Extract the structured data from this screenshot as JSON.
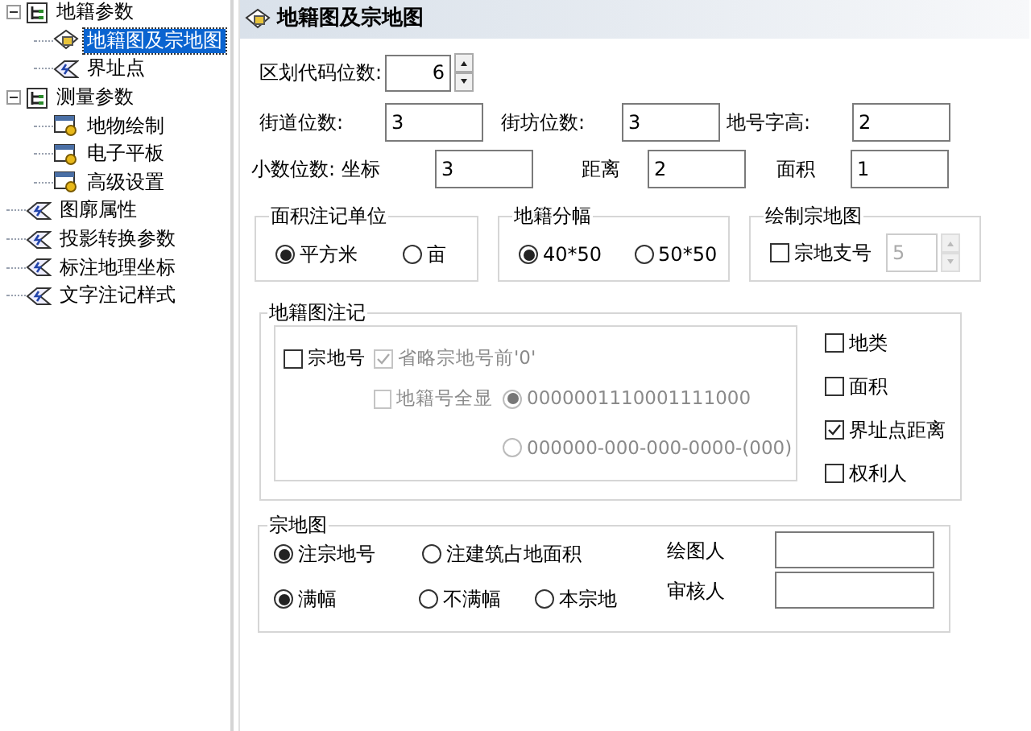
{
  "tree": [
    {
      "label": "地籍参数",
      "kind": "folder",
      "expanded": true,
      "selected": false,
      "children": [
        {
          "label": "地籍图及宗地图",
          "kind": "map",
          "selected": true
        },
        {
          "label": "界址点",
          "kind": "page",
          "selected": false
        }
      ]
    },
    {
      "label": "测量参数",
      "kind": "folder",
      "expanded": true,
      "selected": false,
      "children": [
        {
          "label": "地物绘制",
          "kind": "tool",
          "selected": false
        },
        {
          "label": "电子平板",
          "kind": "tool",
          "selected": false
        },
        {
          "label": "高级设置",
          "kind": "tool",
          "selected": false
        }
      ]
    },
    {
      "label": "图廓属性",
      "kind": "page",
      "selected": false
    },
    {
      "label": "投影转换参数",
      "kind": "page",
      "selected": false
    },
    {
      "label": "标注地理坐标",
      "kind": "page",
      "selected": false
    },
    {
      "label": "文字注记样式",
      "kind": "page",
      "selected": false
    }
  ],
  "title": "地籍图及宗地图",
  "code_digits": {
    "label": "区划代码位数:",
    "value": "6"
  },
  "row_street": [
    {
      "label": "街道位数:",
      "value": "3"
    },
    {
      "label": "街坊位数:",
      "value": "3"
    },
    {
      "label": "地号字高:",
      "value": "2"
    }
  ],
  "row_decimals": [
    {
      "label": "小数位数: 坐标",
      "value": "3"
    },
    {
      "label": "距离",
      "value": "2"
    },
    {
      "label": "面积",
      "value": "1"
    }
  ],
  "area_unit": {
    "title": "面积注记单位",
    "options": [
      {
        "label": "平方米",
        "selected": true
      },
      {
        "label": "亩",
        "selected": false
      }
    ]
  },
  "sheet_size": {
    "title": "地籍分幅",
    "options": [
      {
        "label": "40*50",
        "selected": true
      },
      {
        "label": "50*50",
        "selected": false
      }
    ]
  },
  "parcel_draw": {
    "title": "绘制宗地图",
    "checkbox": {
      "label": "宗地支号",
      "checked": false
    },
    "value": "5",
    "disabled": true
  },
  "annotation": {
    "title": "地籍图注记",
    "parcel_no": {
      "label": "宗地号",
      "checked": false
    },
    "omit_zero": {
      "label": "省略宗地号前'0'",
      "checked": true,
      "disabled": true
    },
    "full_no": {
      "label": "地籍号全显",
      "checked": false,
      "disabled": true
    },
    "formats": [
      {
        "label": "0000001110001111000",
        "selected": true,
        "disabled": true
      },
      {
        "label": "000000-000-000-0000-(000)",
        "selected": false,
        "disabled": true
      }
    ],
    "checks": [
      {
        "label": "地类",
        "checked": false
      },
      {
        "label": "面积",
        "checked": false
      },
      {
        "label": "界址点距离",
        "checked": true
      },
      {
        "label": "权利人",
        "checked": false
      }
    ]
  },
  "parcel_map": {
    "title": "宗地图",
    "label_options": [
      {
        "label": "注宗地号",
        "selected": true
      },
      {
        "label": "注建筑占地面积",
        "selected": false
      }
    ],
    "size_options": [
      {
        "label": "满幅",
        "selected": true
      },
      {
        "label": "不满幅",
        "selected": false
      },
      {
        "label": "本宗地",
        "selected": false
      }
    ],
    "fields": [
      {
        "label": "绘图人"
      },
      {
        "label": "审核人"
      }
    ]
  }
}
